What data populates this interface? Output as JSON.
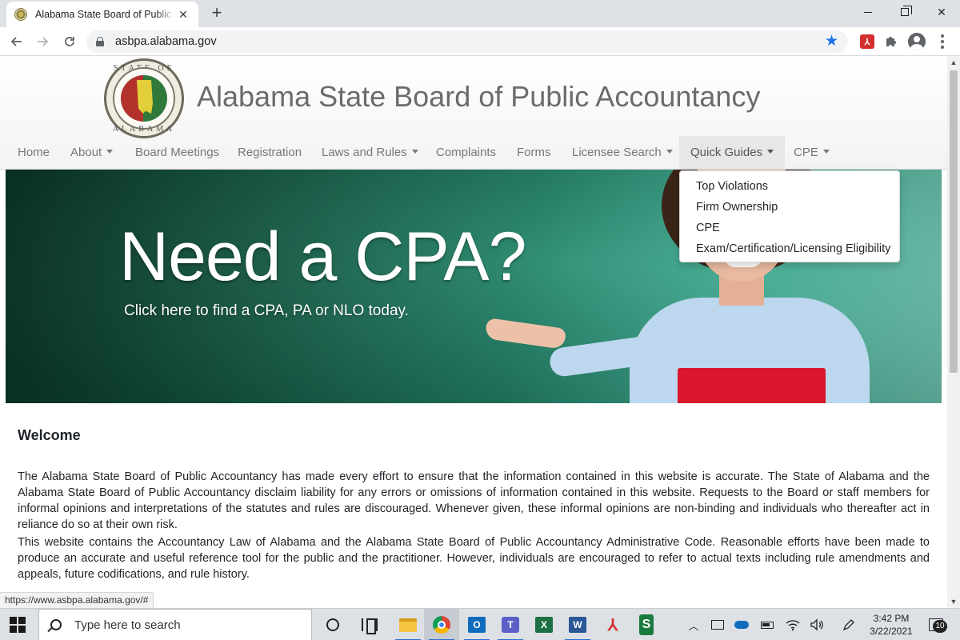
{
  "browser": {
    "tab_title": "Alabama State Board of Public Accountancy",
    "tab_close_glyph": "✕",
    "new_tab_glyph": "+",
    "url": "asbpa.alabama.gov",
    "status_url": "https://www.asbpa.alabama.gov/#",
    "pdf_ext_glyph": "⅄",
    "icons": [
      "back-arrow-icon",
      "forward-arrow-icon",
      "reload-icon",
      "lock-icon",
      "star-icon",
      "acrobat-extension-icon",
      "puzzle-icon",
      "profile-icon",
      "kebab-menu-icon"
    ],
    "accent_color": "#1a73e8"
  },
  "site": {
    "title": "Alabama State Board of Public Accountancy",
    "seal_top_text": "STATE OF",
    "seal_bottom_text": "ALABAMA",
    "nav": [
      {
        "label": "Home",
        "caret": false
      },
      {
        "label": "About",
        "caret": true
      },
      {
        "label": "Board Meetings",
        "caret": false
      },
      {
        "label": "Registration",
        "caret": false
      },
      {
        "label": "Laws and Rules",
        "caret": true
      },
      {
        "label": "Complaints",
        "caret": false
      },
      {
        "label": "Forms",
        "caret": false
      },
      {
        "label": "Licensee Search",
        "caret": true
      },
      {
        "label": "Quick Guides",
        "caret": true,
        "active": true
      },
      {
        "label": "CPE",
        "caret": true
      }
    ],
    "dropdown": [
      "Top Violations",
      "Firm Ownership",
      "CPE",
      "Exam/Certification/Licensing Eligibility"
    ],
    "banner": {
      "headline": "Need a CPA?",
      "subline": "Click here to find a CPA, PA or NLO today."
    },
    "welcome_heading": "Welcome",
    "paragraphs": [
      "The Alabama State Board of Public Accountancy has made every effort to ensure that the information contained in this website is accurate. The State of Alabama and the Alabama State Board of Public Accountancy disclaim liability for any errors or omissions of information contained in this website. Requests to the Board or staff members for informal opinions and interpretations of the statutes and rules are discouraged. Whenever given, these informal opinions are non-binding and individuals who thereafter act in reliance do so at their own risk.",
      "This website contains the Accountancy Law of Alabama and the Alabama State Board of Public Accountancy Administrative Code. Reasonable efforts have been made to produce an accurate and useful reference tool for the public and the practitioner. However, individuals are encouraged to refer to actual texts including rule amendments and appeals, future codifications, and rule history."
    ]
  },
  "taskbar": {
    "search_placeholder": "Type here to search",
    "outlook_letter": "O",
    "teams_letter": "T",
    "excel_letter": "X",
    "word_letter": "W",
    "acrobat_glyph": "⅄",
    "green_app_glyph": "S",
    "time": "3:42 PM",
    "date": "3/22/2021",
    "notification_count": "10"
  }
}
